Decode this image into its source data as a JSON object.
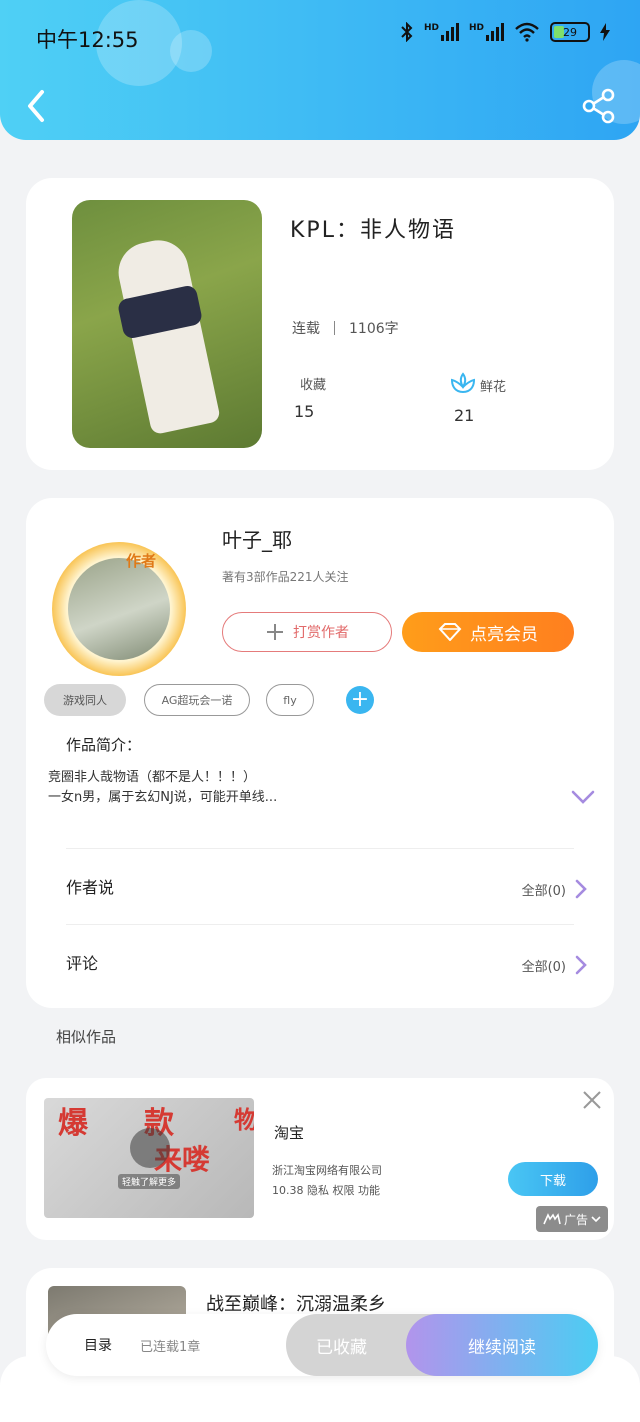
{
  "status_bar": {
    "time": "中午12:55",
    "network_1": "HD",
    "network_2": "HD",
    "battery": "29"
  },
  "header": {
    "back_icon": "chevron-left-icon",
    "share_icon": "share-icon",
    "gradient_start": "#4fd0f5",
    "gradient_end": "#2ea5f3"
  },
  "book": {
    "title": "KPL：非人物语",
    "status": "连载",
    "word_count": "1106字",
    "collect_label": "收藏",
    "collect_count": "15",
    "flower_label": "鲜花",
    "flower_count": "21"
  },
  "author": {
    "badge": "作者",
    "name": "叶子_耶",
    "meta": "著有3部作品221人关注",
    "tip_label": "打赏作者",
    "vip_label": "点亮会员",
    "tags": [
      "游戏同人",
      "AG超玩会一诺",
      "fly"
    ],
    "intro_title": "作品简介：",
    "intro_line1": "竞圈非人哉物语（都不是人！！！）",
    "intro_line2": "一女n男，属于玄幻NJ说，可能开单线...",
    "author_says_label": "作者说",
    "author_says_count": "全部(0)",
    "comments_label": "评论",
    "comments_count": "全部(0)"
  },
  "similar": {
    "section_title": "相似作品",
    "item_title": "战至巅峰：沉溺温柔乡"
  },
  "ad": {
    "name": "淘宝",
    "company": "浙江淘宝网络有限公司",
    "meta": "10.38  隐私  权限  功能",
    "download_label": "下载",
    "badge_label": "广告",
    "image_caption": "轻触了解更多",
    "image_text_1": "爆",
    "image_text_2": "款",
    "image_text_3": "来喽",
    "image_text_4": "物"
  },
  "bottom_bar": {
    "catalog_label": "目录",
    "catalog_status": "已连载1章",
    "collected_label": "已收藏",
    "continue_label": "继续阅读"
  },
  "colors": {
    "accent_blue": "#3ab6f0",
    "vip_orange": "#ff8c1e",
    "tip_red": "#e26a6a",
    "purple": "#a58be0"
  }
}
